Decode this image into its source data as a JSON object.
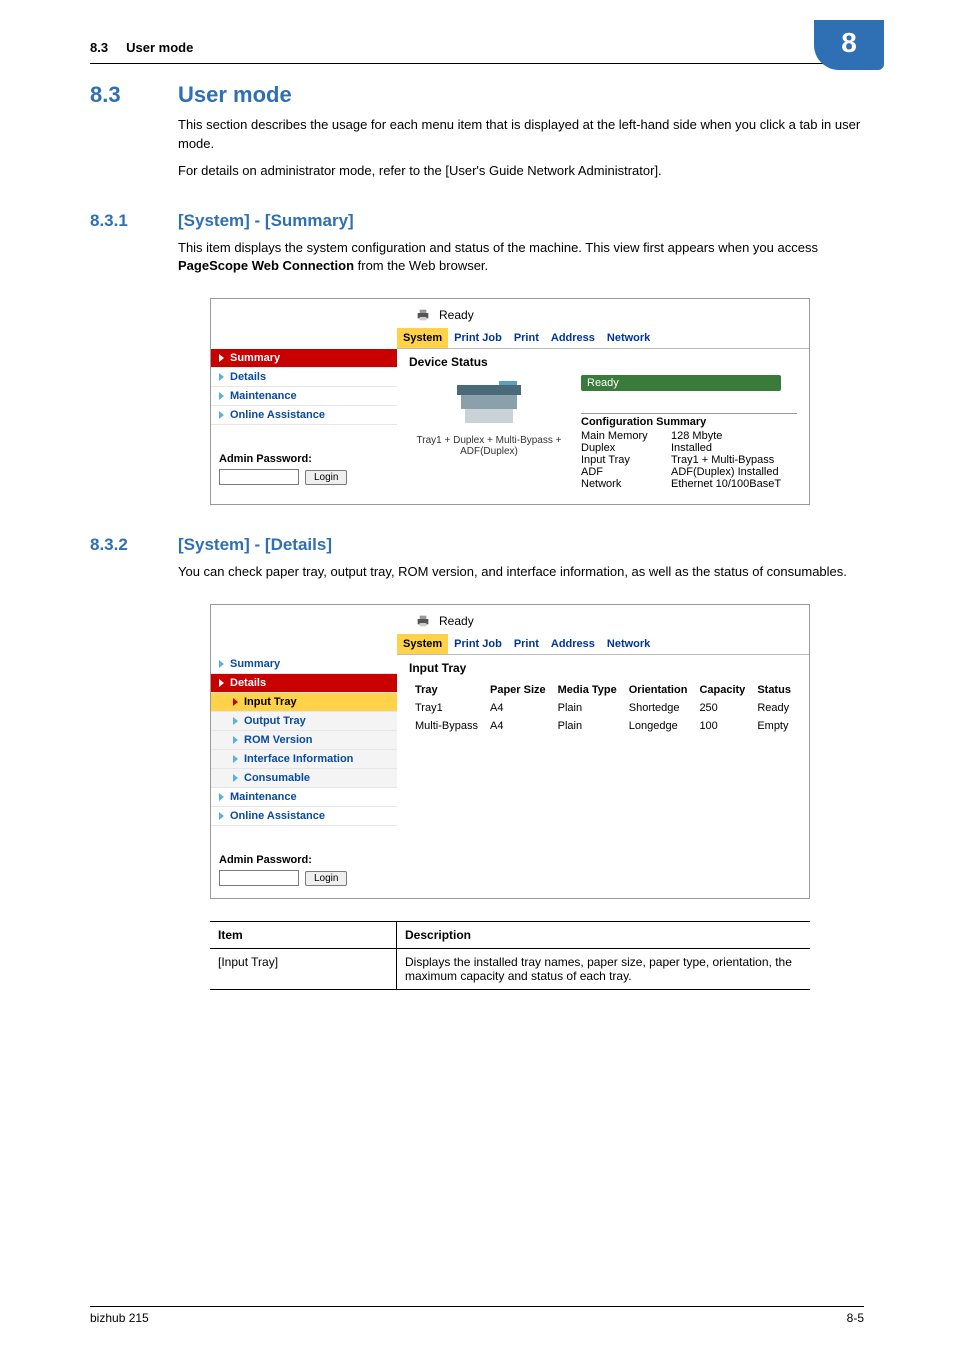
{
  "chapter_badge": "8",
  "breadcrumb": {
    "section_no": "8.3",
    "section_name": "User mode"
  },
  "h2": {
    "num": "8.3",
    "title": "User mode"
  },
  "p1": "This section describes the usage for each menu item that is displayed at the left-hand side when you click a tab in user mode.",
  "p2": "For details on administrator mode, refer to the [User's Guide Network Administrator].",
  "h3a": {
    "num": "8.3.1",
    "title": "[System] - [Summary]"
  },
  "p3": "This item displays the system configuration and status of the machine. This view first appears when you access PageScope Web Connection from the Web browser.",
  "shot1": {
    "status_top": "Ready",
    "tabs": {
      "t0": "System",
      "t1": "Print Job",
      "t2": "Print",
      "t3": "Address",
      "t4": "Network"
    },
    "sidebar": {
      "s0": "Summary",
      "s1": "Details",
      "s2": "Maintenance",
      "s3": "Online Assistance"
    },
    "admin_label": "Admin Password:",
    "login_btn": "Login",
    "panel_title": "Device Status",
    "device_caption_l1": "Tray1 + Duplex + Multi-Bypass +",
    "device_caption_l2": "ADF(Duplex)",
    "ready_banner": "Ready",
    "conf_title": "Configuration Summary",
    "conf": {
      "r0k": "Main Memory",
      "r0v": "128 Mbyte",
      "r1k": "Duplex",
      "r1v": "Installed",
      "r2k": "Input Tray",
      "r2v": "Tray1 + Multi-Bypass",
      "r3k": "ADF",
      "r3v": "ADF(Duplex) Installed",
      "r4k": "Network",
      "r4v": "Ethernet 10/100BaseT"
    }
  },
  "h3b": {
    "num": "8.3.2",
    "title": "[System] - [Details]"
  },
  "p4": "You can check paper tray, output tray, ROM version, and interface information, as well as the status of consumables.",
  "shot2": {
    "status_top": "Ready",
    "tabs": {
      "t0": "System",
      "t1": "Print Job",
      "t2": "Print",
      "t3": "Address",
      "t4": "Network"
    },
    "sidebar": {
      "s0": "Summary",
      "s1": "Details",
      "s1a": "Input Tray",
      "s1b": "Output Tray",
      "s1c": "ROM Version",
      "s1d": "Interface Information",
      "s1e": "Consumable",
      "s2": "Maintenance",
      "s3": "Online Assistance"
    },
    "admin_label": "Admin Password:",
    "login_btn": "Login",
    "panel_title": "Input Tray",
    "th": {
      "c0": "Tray",
      "c1": "Paper Size",
      "c2": "Media Type",
      "c3": "Orientation",
      "c4": "Capacity",
      "c5": "Status"
    },
    "rows": {
      "r0": {
        "c0": "Tray1",
        "c1": "A4",
        "c2": "Plain",
        "c3": "Shortedge",
        "c4": "250",
        "c5": "Ready"
      },
      "r1": {
        "c0": "Multi-Bypass",
        "c1": "A4",
        "c2": "Plain",
        "c3": "Longedge",
        "c4": "100",
        "c5": "Empty"
      }
    }
  },
  "desc": {
    "h0": "Item",
    "h1": "Description",
    "r0c0": "[Input Tray]",
    "r0c1": "Displays the installed tray names, paper size, paper type, orientation, the maximum capacity and status of each tray."
  },
  "footer": {
    "left": "bizhub 215",
    "right": "8-5"
  }
}
